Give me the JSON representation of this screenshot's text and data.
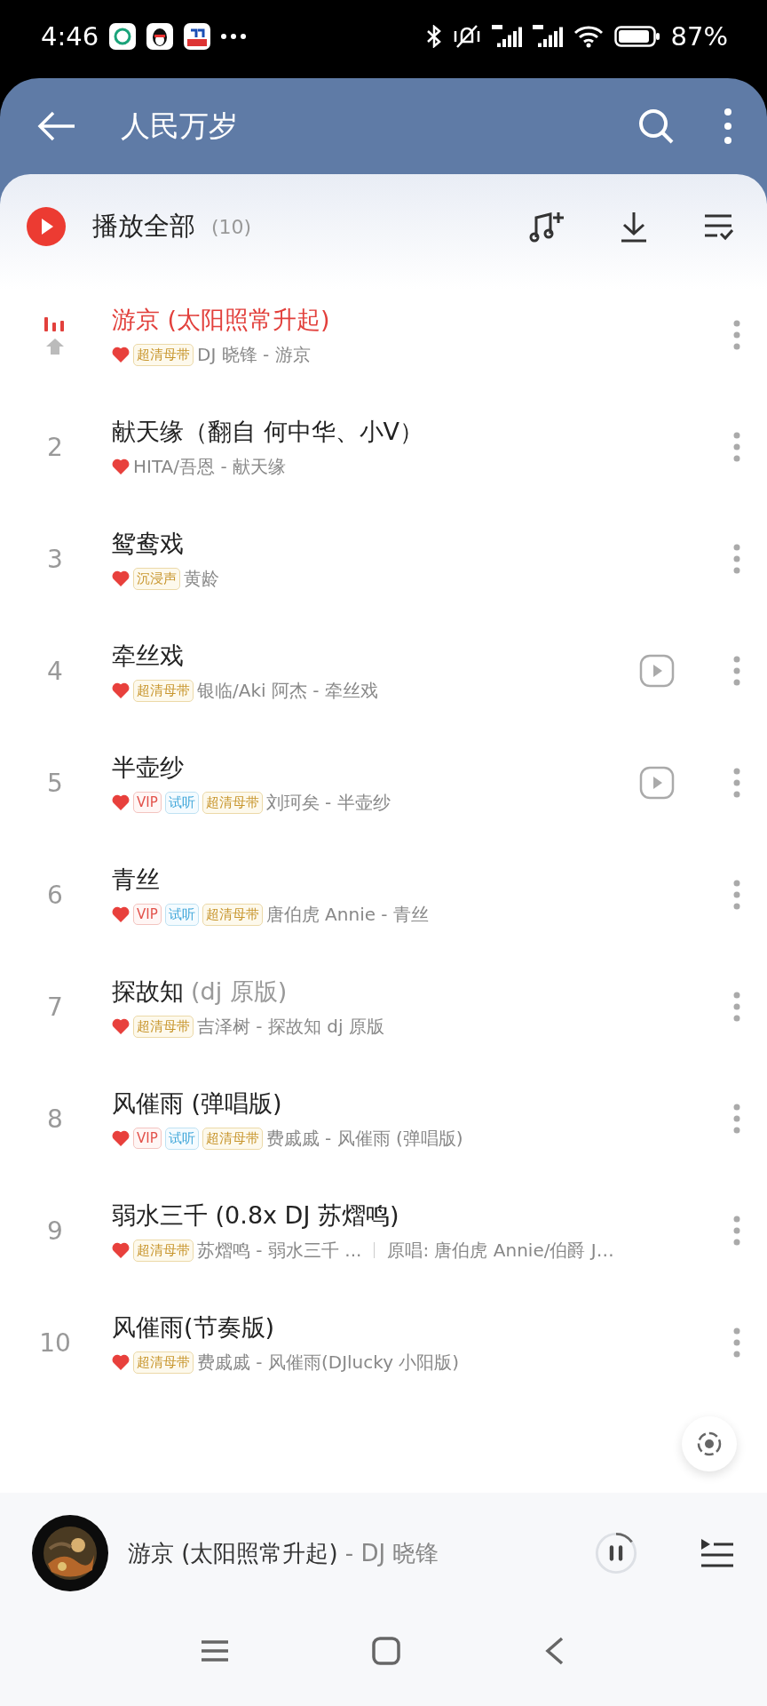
{
  "status_bar": {
    "time": "4:46",
    "battery": "87%"
  },
  "header": {
    "title": "人民万岁"
  },
  "play_all": {
    "label": "播放全部",
    "count": "(10)"
  },
  "songs": [
    {
      "playing": true,
      "title": "游京 (太阳照常升起)",
      "liked": true,
      "tags": [
        {
          "kind": "quality",
          "label": "超清母带"
        }
      ],
      "subtitle": "DJ 晓锋 - 游京",
      "mv": false
    },
    {
      "number": "2",
      "playing": false,
      "title": "献天缘（翻自 何中华、小V）",
      "liked": true,
      "subtitle": "HITA/吾恩 - 献天缘",
      "mv": false
    },
    {
      "number": "3",
      "playing": false,
      "title": "鸳鸯戏",
      "liked": true,
      "tags": [
        {
          "kind": "quality",
          "label": "沉浸声"
        }
      ],
      "subtitle": "黄龄",
      "mv": false
    },
    {
      "number": "4",
      "playing": false,
      "title": "牵丝戏",
      "liked": true,
      "tags": [
        {
          "kind": "quality",
          "label": "超清母带"
        }
      ],
      "subtitle": "银临/Aki 阿杰 - 牵丝戏",
      "mv": true
    },
    {
      "number": "5",
      "playing": false,
      "title": "半壶纱",
      "liked": true,
      "tags": [
        {
          "kind": "vip",
          "label": "VIP"
        },
        {
          "kind": "trial",
          "label": "试听"
        },
        {
          "kind": "quality",
          "label": "超清母带"
        }
      ],
      "subtitle": "刘珂矣 - 半壶纱",
      "mv": true
    },
    {
      "number": "6",
      "playing": false,
      "title": "青丝",
      "liked": true,
      "tags": [
        {
          "kind": "vip",
          "label": "VIP"
        },
        {
          "kind": "trial",
          "label": "试听"
        },
        {
          "kind": "quality",
          "label": "超清母带"
        }
      ],
      "subtitle": "唐伯虎 Annie - 青丝",
      "mv": false
    },
    {
      "number": "7",
      "playing": false,
      "title": "探故知",
      "title_note": "(dj 原版)",
      "liked": true,
      "tags": [
        {
          "kind": "quality",
          "label": "超清母带"
        }
      ],
      "subtitle": "吉泽树 - 探故知 dj 原版",
      "mv": false
    },
    {
      "number": "8",
      "playing": false,
      "title": "风催雨 (弹唱版)",
      "liked": true,
      "tags": [
        {
          "kind": "vip",
          "label": "VIP"
        },
        {
          "kind": "trial",
          "label": "试听"
        },
        {
          "kind": "quality",
          "label": "超清母带"
        }
      ],
      "subtitle": "费戚戚 - 风催雨 (弹唱版)",
      "mv": false
    },
    {
      "number": "9",
      "playing": false,
      "title": "弱水三千 (0.8x DJ 苏熠鸣)",
      "liked": true,
      "tags": [
        {
          "kind": "quality",
          "label": "超清母带"
        }
      ],
      "subtitle": "苏熠鸣 - 弱水三千 ...",
      "original": "原唱: 唐伯虎 Annie/伯爵 J…",
      "mv": false
    },
    {
      "number": "10",
      "playing": false,
      "title": "风催雨(节奏版)",
      "liked": true,
      "tags": [
        {
          "kind": "quality",
          "label": "超清母带"
        }
      ],
      "subtitle": "费戚戚 - 风催雨(DJlucky 小阳版)",
      "mv": false
    }
  ],
  "player": {
    "title": "游京 (太阳照常升起)",
    "artist": " - DJ 晓锋",
    "playing": true
  }
}
